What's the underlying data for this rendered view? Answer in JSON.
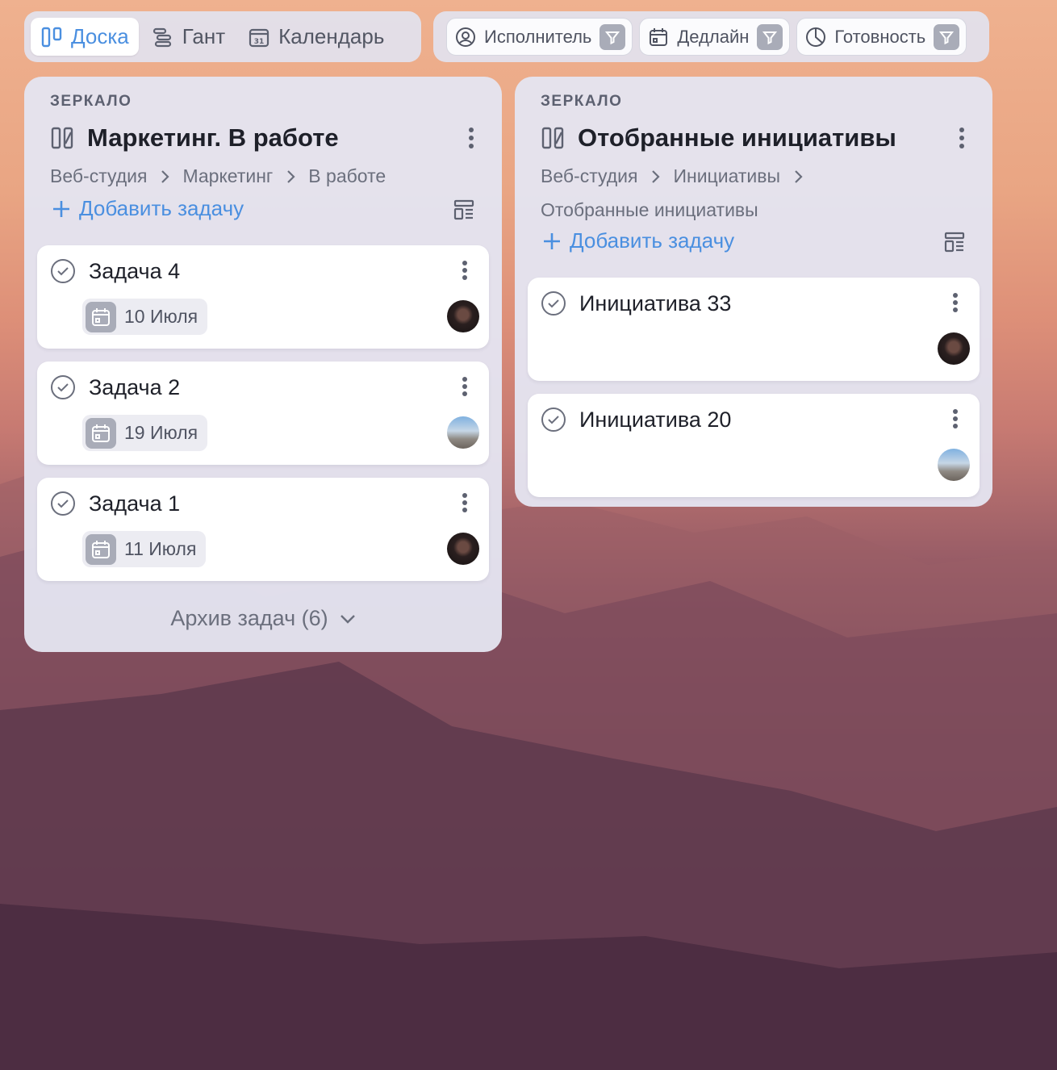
{
  "view_tabs": [
    {
      "label": "Доска",
      "icon": "board-icon",
      "active": true
    },
    {
      "label": "Гант",
      "icon": "gantt-icon",
      "active": false
    },
    {
      "label": "Календарь",
      "icon": "calendar-31-icon",
      "active": false
    }
  ],
  "filters": [
    {
      "label": "Исполнитель",
      "icon": "user-circle-icon"
    },
    {
      "label": "Дедлайн",
      "icon": "calendar-icon"
    },
    {
      "label": "Готовность",
      "icon": "progress-pie-icon"
    }
  ],
  "columns": [
    {
      "label": "ЗЕРКАЛО",
      "title": "Маркетинг. В работе",
      "breadcrumbs": [
        "Веб-студия",
        "Маркетинг",
        "В работе"
      ],
      "add_task": "Добавить задачу",
      "cards": [
        {
          "title": "Задача 4",
          "date": "10 Июля",
          "avatar": "dark"
        },
        {
          "title": "Задача 2",
          "date": "19 Июля",
          "avatar": "light"
        },
        {
          "title": "Задача 1",
          "date": "11 Июля",
          "avatar": "dark"
        }
      ],
      "archive": "Архив задач (6)"
    },
    {
      "label": "ЗЕРКАЛО",
      "title": "Отобранные инициативы",
      "breadcrumbs": [
        "Веб-студия",
        "Инициативы",
        "Отобранные инициативы"
      ],
      "add_task": "Добавить задачу",
      "cards": [
        {
          "title": "Инициатива 33",
          "avatar": "dark"
        },
        {
          "title": "Инициатива 20",
          "avatar": "light"
        }
      ]
    }
  ],
  "colors": {
    "accent": "#4a8fe0",
    "panel": "#e4e4f0",
    "text": "#1e2029",
    "muted": "#6b6f7d"
  }
}
